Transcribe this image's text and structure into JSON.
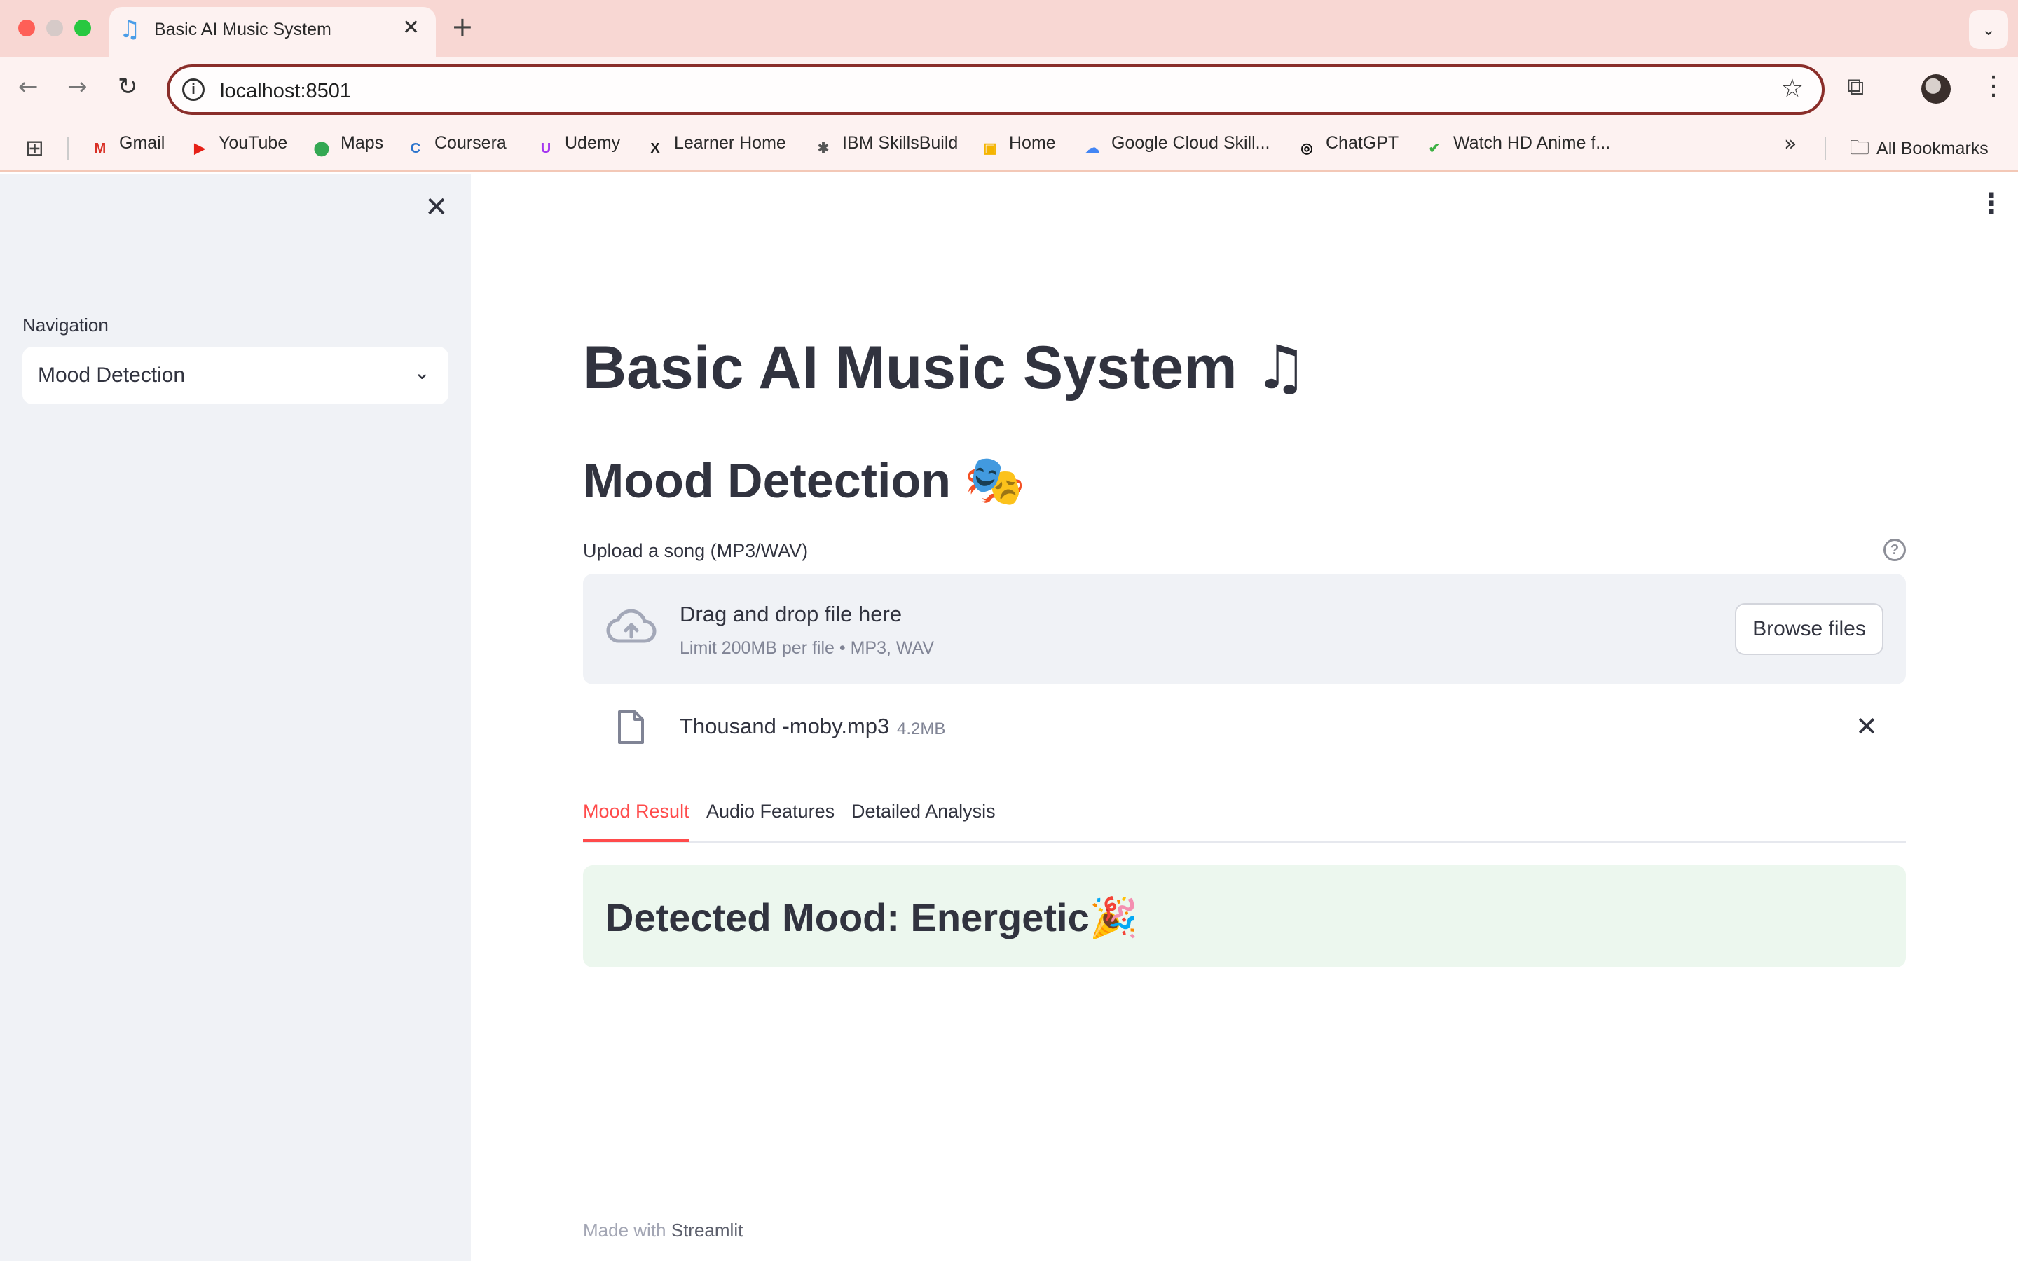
{
  "browser": {
    "tab_title": "Basic AI Music System",
    "tab_favicon": "♫",
    "url": "localhost:8501",
    "bookmarks": [
      {
        "label": "Gmail",
        "icon": "gmail-icon",
        "glyph": "M",
        "color": "#d93025"
      },
      {
        "label": "YouTube",
        "icon": "youtube-icon",
        "glyph": "▶",
        "color": "#e62117"
      },
      {
        "label": "Maps",
        "icon": "maps-icon",
        "glyph": "⬤",
        "color": "#34a853"
      },
      {
        "label": "Coursera",
        "icon": "coursera-icon",
        "glyph": "C",
        "color": "#2a73cc"
      },
      {
        "label": "Udemy",
        "icon": "udemy-icon",
        "glyph": "U",
        "color": "#a435f0"
      },
      {
        "label": "Learner Home",
        "icon": "edx-icon",
        "glyph": "X",
        "color": "#222222"
      },
      {
        "label": "IBM SkillsBuild",
        "icon": "ibm-icon",
        "glyph": "✱",
        "color": "#555555"
      },
      {
        "label": "Home",
        "icon": "classroom-icon",
        "glyph": "▣",
        "color": "#f4b400"
      },
      {
        "label": "Google Cloud Skill...",
        "icon": "google-cloud-icon",
        "glyph": "☁",
        "color": "#4285f4"
      },
      {
        "label": "ChatGPT",
        "icon": "chatgpt-icon",
        "glyph": "◎",
        "color": "#111111"
      },
      {
        "label": "Watch HD Anime f...",
        "icon": "anime-icon",
        "glyph": "✔",
        "color": "#3cb043"
      }
    ],
    "all_bookmarks": "All Bookmarks"
  },
  "sidebar": {
    "nav_label": "Navigation",
    "nav_selected": "Mood Detection"
  },
  "main": {
    "title": "Basic AI Music System",
    "title_emoji": "♫",
    "subtitle": "Mood Detection",
    "subtitle_emoji": "🎭",
    "upload_label": "Upload a song (MP3/WAV)",
    "dropzone_title": "Drag and drop file here",
    "dropzone_limit": "Limit 200MB per file • MP3, WAV",
    "browse_button": "Browse files",
    "file_name": "Thousand -moby.mp3",
    "file_size": "4.2MB",
    "tabs": [
      "Mood Result",
      "Audio Features",
      "Detailed Analysis"
    ],
    "active_tab": "Mood Result",
    "mood_result": "Detected Mood: Energetic",
    "mood_emoji": "🎉",
    "footer_prefix": "Made with",
    "footer_brand": "Streamlit"
  },
  "colors": {
    "accent": "#ff4b4b",
    "sidebar_bg": "#f0f2f6",
    "success_bg": "#ecf7ee",
    "browser_frame": "#f8d7d3"
  }
}
